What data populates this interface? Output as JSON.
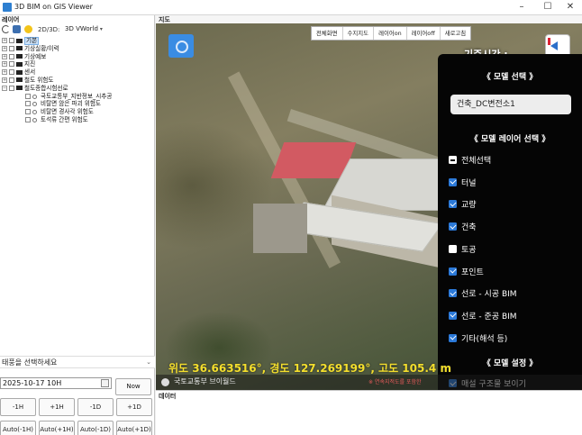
{
  "window": {
    "title": "3D BIM on GIS Viewer",
    "controls": [
      "–",
      "☐",
      "✕"
    ]
  },
  "layer_panel": {
    "header": "레이어",
    "mode_label": "2D/3D:",
    "mode_value": "3D VWorld",
    "tree": [
      {
        "label": "기본",
        "level": 0,
        "expander": "+",
        "check": true,
        "selected": true
      },
      {
        "label": "기상실황/이력",
        "level": 0,
        "expander": "+",
        "check": true
      },
      {
        "label": "기상예보",
        "level": 0,
        "expander": "+",
        "check": true
      },
      {
        "label": "지진",
        "level": 0,
        "expander": "+",
        "check": true
      },
      {
        "label": "센서",
        "level": 0,
        "expander": "+",
        "check": true
      },
      {
        "label": "철도 위험도",
        "level": 0,
        "expander": "+",
        "check": true
      },
      {
        "label": "철도종합시험선로",
        "level": 0,
        "expander": "−",
        "check": true
      },
      {
        "label": "국토교통부_지반정보_시추공",
        "level": 1,
        "check": true
      },
      {
        "label": "비탈면 암은 파괴 위험도",
        "level": 1,
        "check": true
      },
      {
        "label": "비탈면 경사각 위험도",
        "level": 1,
        "check": true
      },
      {
        "label": "토석류 간편 위험도",
        "level": 1,
        "check": true
      }
    ]
  },
  "controls": {
    "theme_placeholder": "태풍을 선택하세요",
    "date_value": "2025-10-17 10H",
    "now_label": "Now",
    "step_buttons": [
      "-1H",
      "+1H",
      "-1D",
      "+1D"
    ],
    "auto_buttons": [
      "Auto(-1H)",
      "Auto(+1H)",
      "Auto(-1D)",
      "Auto(+1D)"
    ]
  },
  "map": {
    "header": "지도",
    "toolbar": [
      "전체화면",
      "수지지도",
      "레이어on",
      "레이어off",
      "새로고침"
    ],
    "overlay_title": "기준시간 :",
    "coords": "위도 36.663516°, 경도 127.269199°, 고도 105.4 m",
    "footer_label": "국토교통부 브이월드",
    "footer_note": "※ 연속지적도를 포함한"
  },
  "model_panel": {
    "model_title": "《 모델 선택 》",
    "model_value": "건축_DC변전소1",
    "layer_title": "《 모델 레이어 선택 》",
    "options": [
      {
        "label": "전체선택",
        "state": "partial"
      },
      {
        "label": "터널",
        "state": "on"
      },
      {
        "label": "교량",
        "state": "on"
      },
      {
        "label": "건축",
        "state": "on"
      },
      {
        "label": "토공",
        "state": "off"
      },
      {
        "label": "포인트",
        "state": "on"
      },
      {
        "label": "선로 - 시공 BIM",
        "state": "on"
      },
      {
        "label": "선로 - 준공 BIM",
        "state": "on"
      },
      {
        "label": "기타(해석 등)",
        "state": "on"
      }
    ],
    "settings_title": "《 모델 설정 》",
    "settings_options": [
      {
        "label": "매설 구조물 보이기",
        "state": "on"
      }
    ]
  },
  "data_pane": {
    "header": "데이터"
  },
  "colors": {
    "accent": "#2b79d8",
    "coords_text": "#f4df2c",
    "footer_note": "#e65a5a",
    "panel_bg": "#050505"
  }
}
